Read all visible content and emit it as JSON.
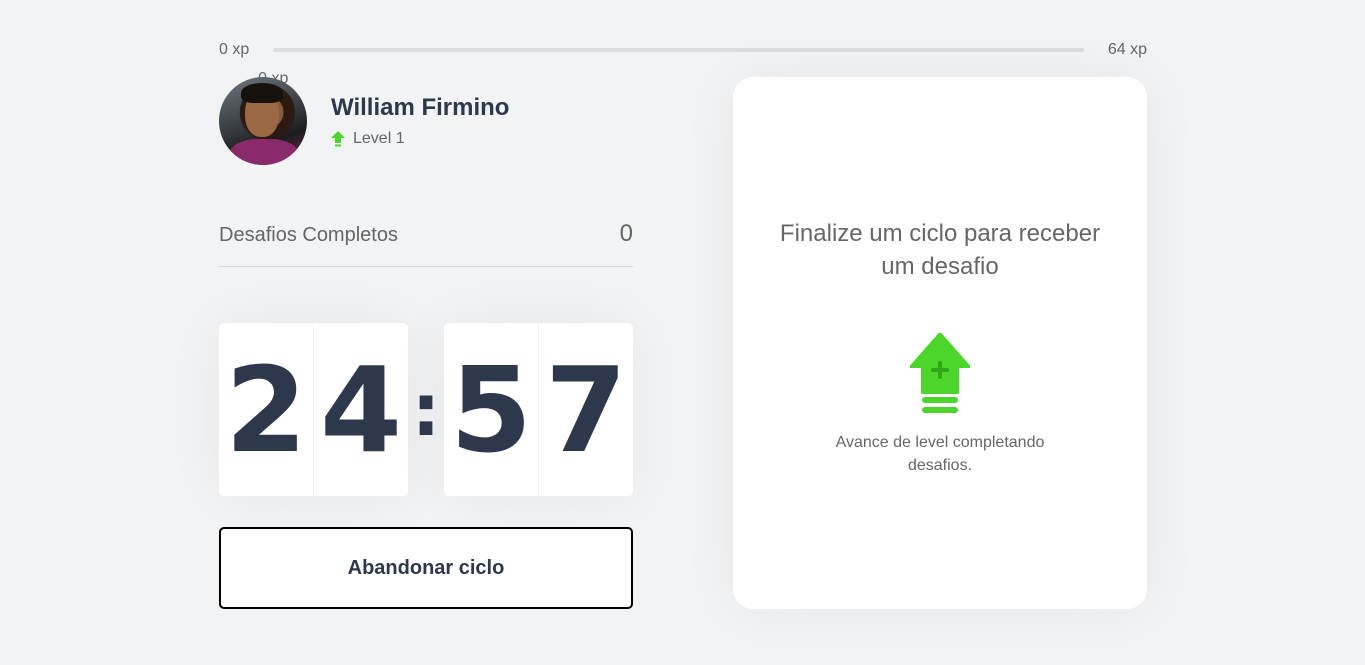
{
  "xp_bar": {
    "min_label": "0 xp",
    "max_label": "64 xp",
    "current_label": "0 xp",
    "progress_percent": 0
  },
  "profile": {
    "name": "William Firmino",
    "level_label": "Level 1"
  },
  "completed_challenges": {
    "label": "Desafios Completos",
    "count": "0"
  },
  "countdown": {
    "minute_left": "2",
    "minute_right": "4",
    "separator": ":",
    "second_left": "5",
    "second_right": "7"
  },
  "abandon_button": {
    "label": "Abandonar ciclo"
  },
  "challenge_box": {
    "title": "Finalize um ciclo para receber um desafio",
    "description": "Avance de level completando desafios."
  },
  "icons": {
    "level": "level-up-arrow-icon",
    "level_up": "level-up-icon"
  },
  "colors": {
    "accent_green": "#4cd62b",
    "title_dark": "#2e384d",
    "text_gray": "#666666",
    "background": "#f2f3f5"
  }
}
